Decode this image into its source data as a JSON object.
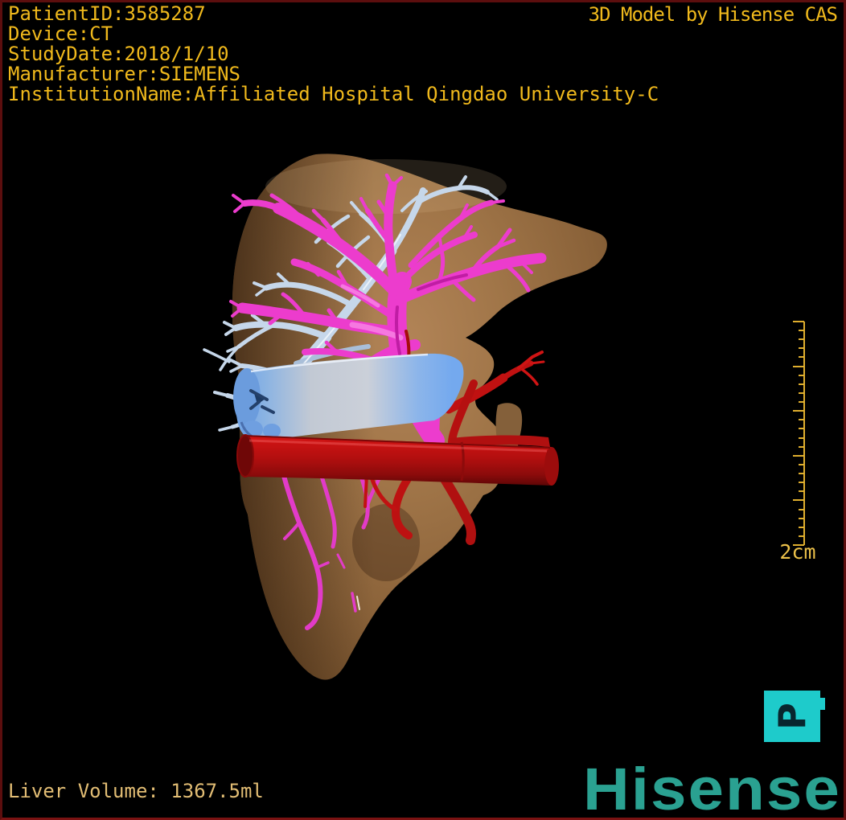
{
  "frame": {
    "background": "#000000",
    "border_color": "#5c0e0e"
  },
  "annotations": {
    "patient_info_lines": [
      "PatientID:3585287",
      "Device:CT",
      "StudyDate:2018/1/10",
      "Manufacturer:SIEMENS",
      "InstitutionName:Affiliated Hospital Qingdao University-C"
    ],
    "watermark_title": "3D Model by Hisense CAS",
    "liver_volume": "Liver Volume: 1367.5ml",
    "text_color": "#f0b91c",
    "volume_text_color": "#e2bd74"
  },
  "scale_ruler": {
    "label": "2cm",
    "color": "#dfae2e"
  },
  "orientation_marker": {
    "letter": "P",
    "box_color": "#1ecbcb",
    "letter_color": "#08262e"
  },
  "brand": {
    "logo_text": "Hisense",
    "color": "#2aa191"
  },
  "model_colors": {
    "liver_parenchyma": "#9c7245",
    "portal_vein_magenta": "#ec3ccd",
    "hepatic_vein_pale_blue": "#c6d7ea",
    "inferior_vena_cava_blue": "#74a9ee",
    "artery_red": "#c21111"
  }
}
